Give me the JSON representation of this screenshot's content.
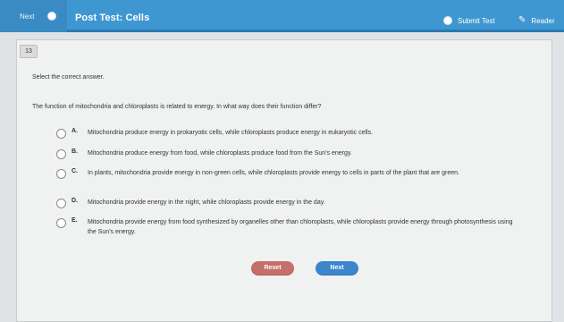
{
  "topbar": {
    "back_label": "Next",
    "title": "Post Test: Cells",
    "submit_label": "Submit Test",
    "reader_label": "Reader"
  },
  "question": {
    "number": "13",
    "instruction": "Select the correct answer.",
    "prompt": "The function of mitochondria and chloroplasts is related to energy. In what way does their function differ?",
    "choices": [
      {
        "letter": "A.",
        "text": "Mitochondria produce energy in prokaryotic cells, while chloroplasts produce energy in eukaryotic cells."
      },
      {
        "letter": "B.",
        "text": "Mitochondria produce energy from food, while chloroplasts produce food from the Sun’s energy."
      },
      {
        "letter": "C.",
        "text": "In plants, mitochondria provide energy in non-green cells, while chloroplasts provide energy to cells in parts of the plant that are green."
      },
      {
        "letter": "D.",
        "text": "Mitochondria provide energy in the night, while chloroplasts provide energy in the day."
      },
      {
        "letter": "E.",
        "text": "Mitochondria provide energy from food synthesized by organelles other than chloroplasts, while chloroplasts provide energy through photosynthesis using the Sun’s energy."
      }
    ]
  },
  "buttons": {
    "reset_label": "Reset",
    "next_label": "Next"
  },
  "colors": {
    "topbar": "#3f97d1",
    "reset": "#c66f68",
    "next": "#3c86cd"
  },
  "icons": {
    "back": "circle-icon",
    "submit": "circle-icon",
    "reader": "pen-icon"
  }
}
